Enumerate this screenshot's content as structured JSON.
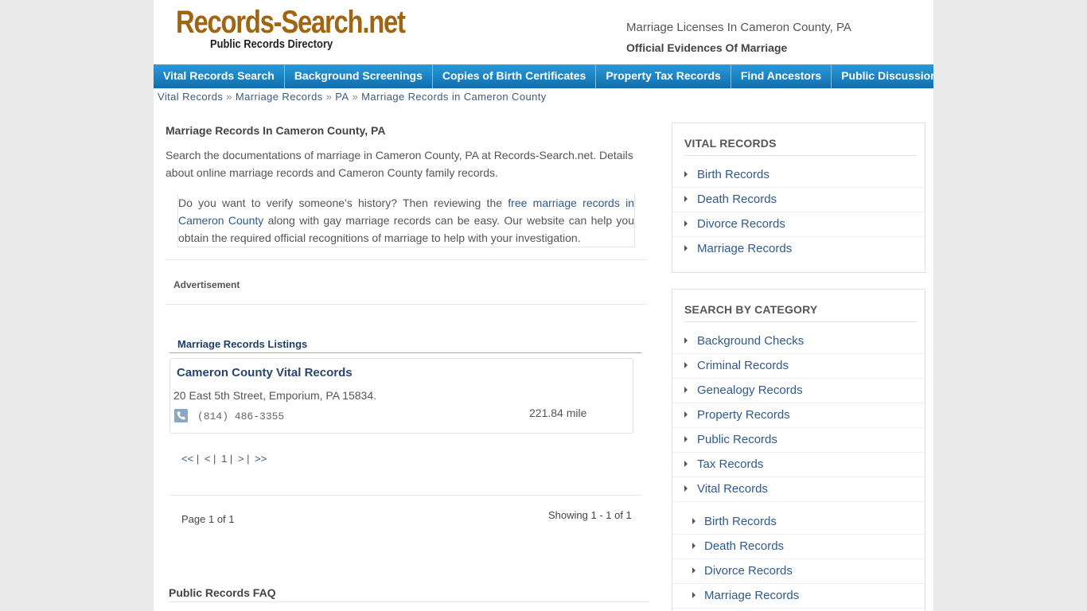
{
  "header": {
    "logo_main": "Records-Search.net",
    "logo_sub": "Public Records Directory",
    "title": "Marriage Licenses In Cameron County, PA",
    "subtitle": "Official Evidences Of Marriage"
  },
  "nav": {
    "items": [
      {
        "label": "Vital Records Search"
      },
      {
        "label": "Background Screenings"
      },
      {
        "label": "Copies of Birth Certificates"
      },
      {
        "label": "Property Tax Records"
      },
      {
        "label": "Find Ancestors"
      },
      {
        "label": "Public Discussion"
      }
    ]
  },
  "breadcrumb": {
    "items": [
      "Vital Records",
      "Marriage Records",
      "PA",
      "Marriage Records in Cameron County"
    ],
    "separator": "»"
  },
  "main": {
    "title": "Marriage Records In Cameron County, PA",
    "intro": "Search the documentations of marriage in Cameron County, PA at Records-Search.net. Details about online marriage records and Cameron County family records.",
    "quote_before": "Do you want to verify someone's history? Then reviewing the ",
    "quote_link": "free marriage records in Cameron County",
    "quote_after": " along with gay marriage records can be easy. Our website can help you obtain the required official recognitions of marriage to help with your investigation.",
    "ad_label": "Advertisement",
    "listings_title": "Marriage Records Listings",
    "listing": {
      "name": "Cameron County Vital Records",
      "address": "20 East 5th Street, Emporium, PA 15834.",
      "phone": "(814) 486-3355",
      "distance": "221.84 mile",
      "phone_icon": "phone-icon"
    },
    "pager": {
      "first": "<<",
      "prev": "<",
      "current": "1",
      "next": ">",
      "last": ">>",
      "sep": "|"
    },
    "page_of": "Page 1 of 1",
    "showing": "Showing 1 - 1 of 1",
    "faq_title": "Public Records FAQ"
  },
  "sidebar": {
    "vital": {
      "title": "VITAL RECORDS",
      "items": [
        "Birth Records",
        "Death Records",
        "Divorce Records",
        "Marriage Records"
      ]
    },
    "category": {
      "title": "SEARCH BY CATEGORY",
      "items": [
        "Background Checks",
        "Criminal Records",
        "Genealogy Records",
        "Property Records",
        "Public Records",
        "Tax Records",
        "Vital Records"
      ],
      "sub_items": [
        "Birth Records",
        "Death Records",
        "Divorce Records",
        "Marriage Records"
      ]
    }
  },
  "colors": {
    "nav_top": "#2c99d6",
    "nav_bottom": "#0d6fb1",
    "logo": "#a2650f",
    "link": "#2f5a8c"
  }
}
